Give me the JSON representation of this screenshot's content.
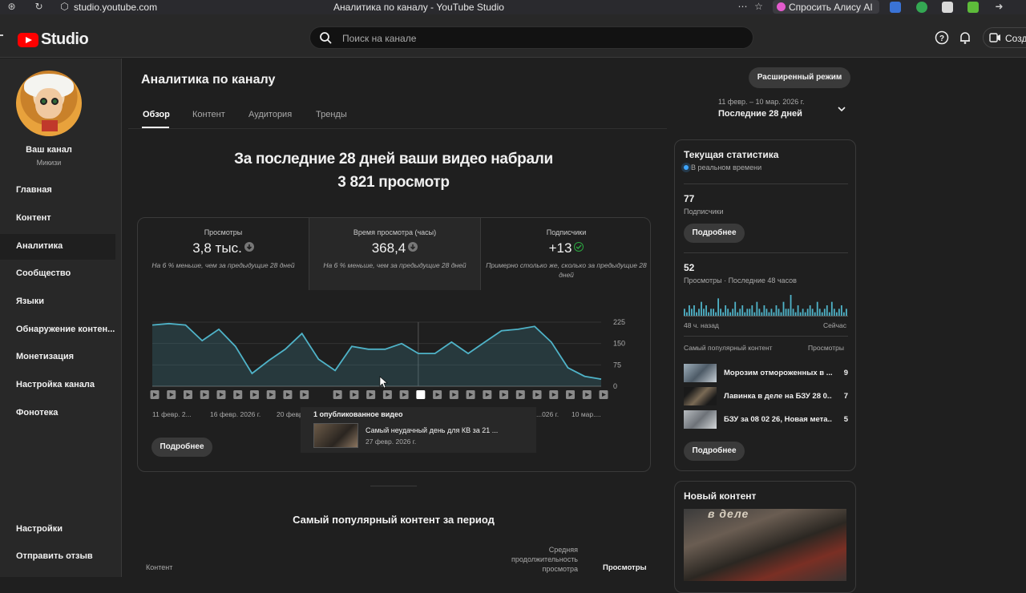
{
  "browser": {
    "url": "studio.youtube.com",
    "tab_title": "Аналитика по каналу - YouTube Studio",
    "assistant_label": "Спросить Алису AI"
  },
  "app": {
    "brand": "Studio",
    "search_placeholder": "Поиск на канале",
    "create_label": "Созда"
  },
  "channel": {
    "name": "Ваш канал",
    "handle": "Микизи"
  },
  "nav": {
    "items": [
      {
        "label": "Главная"
      },
      {
        "label": "Контент"
      },
      {
        "label": "Аналитика"
      },
      {
        "label": "Сообщество"
      },
      {
        "label": "Языки"
      },
      {
        "label": "Обнаружение контен..."
      },
      {
        "label": "Монетизация"
      },
      {
        "label": "Настройка канала"
      },
      {
        "label": "Фонотека"
      }
    ],
    "bottom": [
      {
        "label": "Настройки"
      },
      {
        "label": "Отправить отзыв"
      }
    ]
  },
  "page": {
    "title": "Аналитика по каналу",
    "advanced_button": "Расширенный режим",
    "tabs": [
      {
        "label": "Обзор"
      },
      {
        "label": "Контент"
      },
      {
        "label": "Аудитория"
      },
      {
        "label": "Тренды"
      }
    ],
    "date_range": "11 февр. – 10 мар. 2026 г.",
    "date_period": "Последние 28 дней",
    "headline_line1": "За последние 28 дней ваши видео набрали",
    "headline_line2": "3 821 просмотр"
  },
  "metrics": [
    {
      "label": "Просмотры",
      "value": "3,8 тыс.",
      "note": "На 6 % меньше, чем за предыдущие 28 дней"
    },
    {
      "label": "Время просмотра (часы)",
      "value": "368,4",
      "note": "На 6 % меньше, чем за предыдущие 28 дней"
    },
    {
      "label": "Подписчики",
      "value": "+13",
      "note": "Примерно столько же, сколько за предыдущие 28 дней"
    }
  ],
  "chart_data": {
    "type": "area",
    "y_ticks": [
      "225",
      "150",
      "75",
      "0"
    ],
    "ylim": [
      0,
      225
    ],
    "x_tick_labels": [
      "11 февр. 2...",
      "16 февр. 2026 г.",
      "20 февр...",
      "...026 г.",
      "10 мар...."
    ],
    "values": [
      215,
      220,
      215,
      160,
      200,
      140,
      45,
      90,
      130,
      185,
      95,
      55,
      140,
      130,
      130,
      150,
      115,
      115,
      155,
      115,
      155,
      195,
      200,
      210,
      155,
      65,
      35,
      25
    ],
    "highlighted_index": 16,
    "color": "#4fb3c8"
  },
  "tooltip": {
    "header": "1 опубликованное видео",
    "video_title": "Самый неудачный день для КВ за 21 ...",
    "video_date": "27 февр. 2026 г."
  },
  "more_button": "Подробнее",
  "popular": {
    "heading": "Самый популярный контент за период",
    "col_content": "Контент",
    "col_avg": "Средняя продолжительность просмотра",
    "col_views": "Просмотры"
  },
  "realtime": {
    "title": "Текущая статистика",
    "live": "В реальном времени",
    "subscribers_value": "77",
    "subscribers_label": "Подписчики",
    "more_button": "Подробнее",
    "views_value": "52",
    "views_label": "Просмотры · Последние 48 часов",
    "mini_values": [
      2,
      1,
      3,
      2,
      3,
      1,
      2,
      4,
      2,
      3,
      1,
      2,
      2,
      1,
      5,
      2,
      1,
      3,
      2,
      1,
      2,
      4,
      1,
      2,
      3,
      1,
      2,
      2,
      3,
      1,
      4,
      2,
      1,
      3,
      2,
      1,
      2,
      1,
      3,
      2,
      1,
      4,
      2,
      2,
      6,
      2,
      1,
      3,
      1,
      2,
      1,
      2,
      3,
      2,
      1,
      4,
      2,
      1,
      2,
      3,
      1,
      4,
      2,
      1,
      2,
      3,
      1,
      2
    ],
    "mini_color": "#4fb3c8",
    "axis_left": "48 ч. назад",
    "axis_right": "Сейчас",
    "popular_label": "Самый популярный контент",
    "popular_views_label": "Просмотры",
    "popular_items": [
      {
        "title": "Морозим отмороженных в ...",
        "views": "9"
      },
      {
        "title": "Лавинка в деле на БЗУ 28 0...",
        "views": "7"
      },
      {
        "title": "БЗУ за 08 02 26, Новая мета...",
        "views": "5"
      }
    ],
    "more_button2": "Подробнее"
  },
  "new_content": {
    "title": "Новый контент",
    "thumb_caption": "в деле"
  }
}
